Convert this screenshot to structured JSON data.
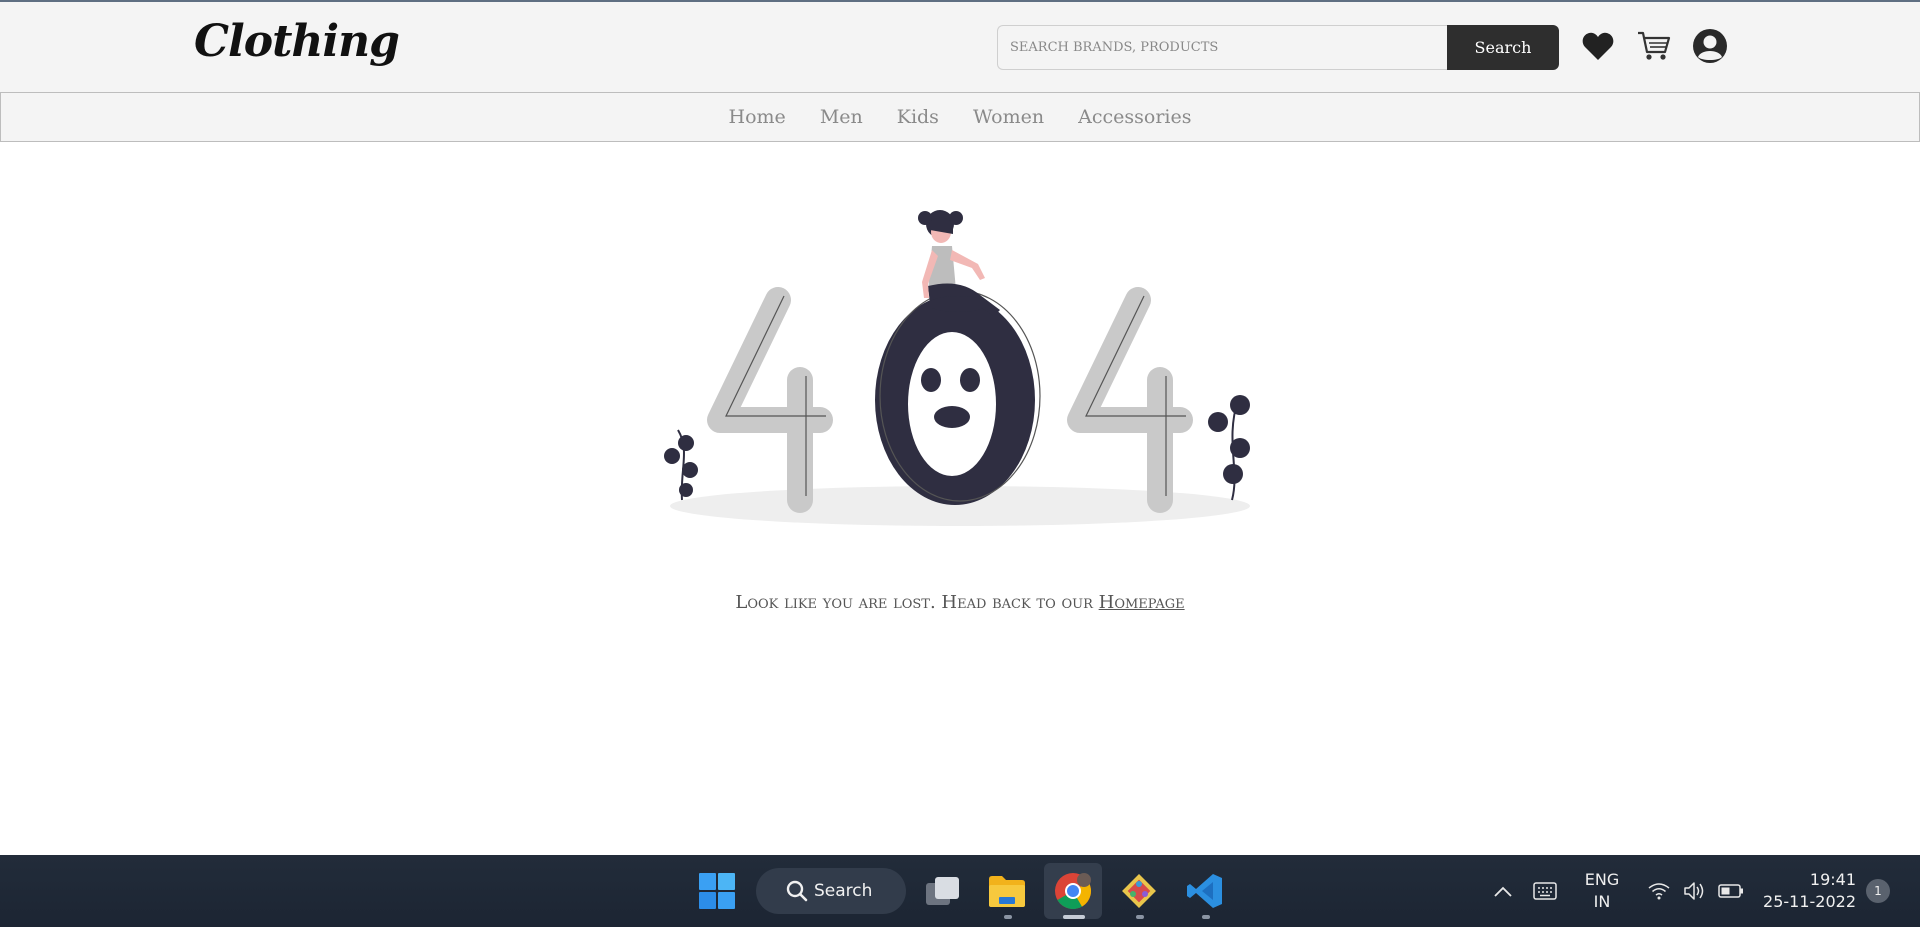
{
  "header": {
    "logo": "Clothing",
    "search_placeholder": "SEARCH BRANDS, PRODUCTS",
    "search_button": "Search",
    "icons": [
      "heart-icon",
      "cart-icon",
      "user-icon"
    ]
  },
  "nav": {
    "items": [
      "Home",
      "Men",
      "Kids",
      "Women",
      "Accessories"
    ]
  },
  "main": {
    "message": "Look like you are lost. Head back to our",
    "link": "Homepage",
    "illustration_text": "404"
  },
  "taskbar": {
    "search_label": "Search",
    "language_line1": "ENG",
    "language_line2": "IN",
    "time": "19:41",
    "date": "25-11-2022",
    "notification_count": "1"
  },
  "colors": {
    "header_bg": "#f4f4f4",
    "dark": "#2e2e2e",
    "illus_dark": "#2f2e41",
    "illus_grey": "#c4c4c4",
    "skin": "#f2b8b5",
    "taskbar": "#1f2937"
  }
}
